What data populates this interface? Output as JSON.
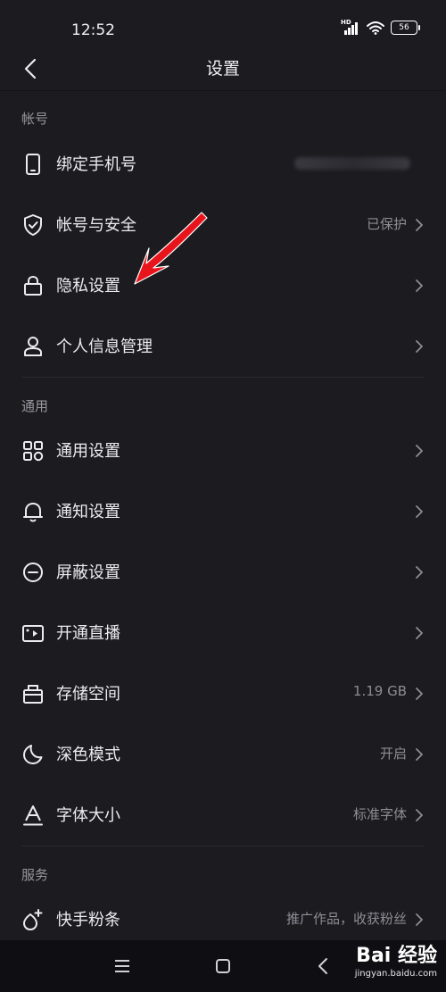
{
  "status_bar": {
    "time": "12:52",
    "network_label": "HD",
    "battery": "56"
  },
  "nav": {
    "title": "设置"
  },
  "sections": {
    "account": {
      "header": "帐号",
      "items": [
        {
          "label": "绑定手机号",
          "value": ""
        },
        {
          "label": "帐号与安全",
          "value": "已保护"
        },
        {
          "label": "隐私设置",
          "value": ""
        },
        {
          "label": "个人信息管理",
          "value": ""
        }
      ]
    },
    "general": {
      "header": "通用",
      "items": [
        {
          "label": "通用设置",
          "value": ""
        },
        {
          "label": "通知设置",
          "value": ""
        },
        {
          "label": "屏蔽设置",
          "value": ""
        },
        {
          "label": "开通直播",
          "value": ""
        },
        {
          "label": "存储空间",
          "value": "1.19 GB"
        },
        {
          "label": "深色模式",
          "value": "开启"
        },
        {
          "label": "字体大小",
          "value": "标准字体"
        }
      ]
    },
    "service": {
      "header": "服务",
      "items": [
        {
          "label": "快手粉条",
          "value": "推广作品，收获粉丝"
        }
      ]
    }
  },
  "icons": {
    "phone": "phone-icon",
    "shield": "shield-check-icon",
    "lock": "lock-icon",
    "person": "person-icon",
    "grid": "grid-icon",
    "bell": "bell-icon",
    "block": "block-icon",
    "camera": "video-camera-icon",
    "storage": "storage-box-icon",
    "moon": "moon-icon",
    "font": "font-size-icon",
    "fan": "sparkle-icon"
  },
  "watermark": {
    "logo": "Bai 经验",
    "url": "jingyan.baidu.com"
  },
  "colors": {
    "background": "#1c1b20",
    "text": "#ecebef",
    "secondary": "#8e8d94",
    "arrow": "#e8141c"
  }
}
